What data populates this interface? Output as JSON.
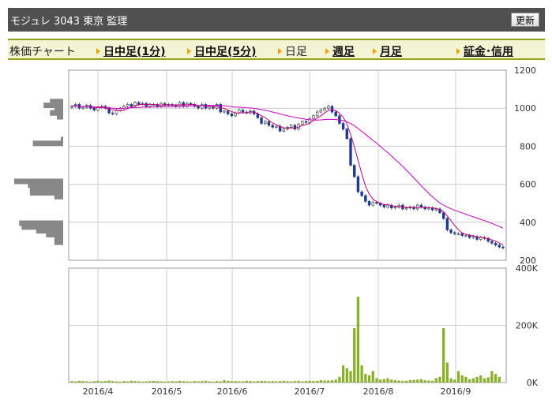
{
  "header": {
    "title": "モジュレ 3043 東京 監理",
    "refresh_label": "更新"
  },
  "nav": {
    "label": "株価チャート",
    "items": [
      {
        "label": "日中足(1分)",
        "active": false
      },
      {
        "label": "日中足(5分)",
        "active": false
      },
      {
        "label": "日足",
        "active": true
      },
      {
        "label": "週足",
        "active": false
      },
      {
        "label": "月足",
        "active": false
      },
      {
        "label": "証金･信用",
        "active": false
      }
    ]
  },
  "colors": {
    "candle_up": "#ffffff",
    "candle_down": "#1f3a93",
    "ma_short": "#c8007a",
    "ma_long": "#c300c3",
    "volume": "#8ab02a",
    "profile_bar": "#888888"
  },
  "chart_data": {
    "type": "candlestick",
    "x_tick_labels": [
      "2016/4",
      "2016/5",
      "2016/6",
      "2016/7",
      "2016/8",
      "2016/9"
    ],
    "price_axis": {
      "ylim": [
        200,
        1200
      ],
      "ticks": [
        200,
        400,
        600,
        800,
        1000,
        1200
      ]
    },
    "volume_axis": {
      "ylim": [
        0,
        400000
      ],
      "ticks": [
        0,
        200000,
        400000
      ],
      "tick_labels": [
        "0K",
        "200K",
        "400K"
      ]
    },
    "price_close": [
      1010,
      1020,
      1000,
      1005,
      1015,
      1000,
      990,
      1005,
      1010,
      1000,
      975,
      970,
      990,
      1000,
      1010,
      1020,
      1010,
      1030,
      1020,
      1025,
      1010,
      1020,
      1020,
      1010,
      1025,
      1015,
      1020,
      1015,
      1010,
      1030,
      1010,
      1025,
      1020,
      1010,
      1000,
      1020,
      1000,
      1010,
      1000,
      1020,
      980,
      985,
      970,
      960,
      975,
      990,
      980,
      975,
      985,
      970,
      950,
      920,
      930,
      910,
      900,
      905,
      880,
      890,
      900,
      910,
      890,
      915,
      930,
      925,
      945,
      960,
      980,
      990,
      1000,
      1010,
      980,
      960,
      920,
      890,
      840,
      700,
      640,
      560,
      540,
      510,
      490,
      505,
      500,
      490,
      480,
      490,
      475,
      480,
      490,
      470,
      475,
      480,
      470,
      490,
      480,
      470,
      475,
      465,
      470,
      450,
      420,
      360,
      345,
      340,
      340,
      330,
      330,
      320,
      325,
      310,
      320,
      315,
      300,
      290,
      280,
      270,
      265
    ],
    "volume_k": [
      5,
      4,
      6,
      5,
      4,
      3,
      5,
      6,
      4,
      5,
      7,
      5,
      4,
      3,
      5,
      4,
      6,
      5,
      4,
      3,
      4,
      5,
      6,
      5,
      4,
      3,
      4,
      5,
      4,
      6,
      5,
      4,
      3,
      5,
      4,
      5,
      6,
      4,
      3,
      5,
      4,
      8,
      6,
      5,
      5,
      4,
      4,
      6,
      5,
      4,
      5,
      6,
      5,
      4,
      5,
      4,
      5,
      6,
      5,
      4,
      5,
      6,
      4,
      5,
      6,
      5,
      6,
      8,
      7,
      7,
      8,
      10,
      20,
      60,
      50,
      40,
      190,
      300,
      60,
      30,
      25,
      40,
      15,
      10,
      12,
      15,
      10,
      8,
      7,
      6,
      6,
      8,
      9,
      10,
      12,
      8,
      7,
      6,
      15,
      20,
      190,
      70,
      15,
      10,
      40,
      25,
      20,
      12,
      15,
      20,
      25,
      15,
      18,
      40,
      30,
      20
    ],
    "volume_profile": [
      {
        "price": 1035,
        "share": 0.27
      },
      {
        "price": 1015,
        "share": 0.4
      },
      {
        "price": 995,
        "share": 0.18
      },
      {
        "price": 975,
        "share": 0.27
      },
      {
        "price": 955,
        "share": 0.13
      },
      {
        "price": 835,
        "share": 0.05
      },
      {
        "price": 815,
        "share": 0.62
      },
      {
        "price": 615,
        "share": 1.0
      },
      {
        "price": 595,
        "share": 0.72
      },
      {
        "price": 575,
        "share": 0.68
      },
      {
        "price": 555,
        "share": 0.68
      },
      {
        "price": 535,
        "share": 0.18
      },
      {
        "price": 395,
        "share": 0.9
      },
      {
        "price": 375,
        "share": 0.85
      },
      {
        "price": 355,
        "share": 0.55
      },
      {
        "price": 335,
        "share": 0.35
      },
      {
        "price": 315,
        "share": 0.18
      },
      {
        "price": 295,
        "share": 0.18
      }
    ]
  }
}
